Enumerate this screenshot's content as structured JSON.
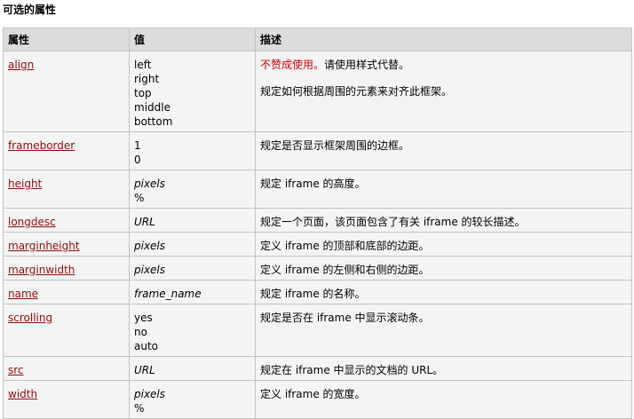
{
  "heading": "可选的属性",
  "columns": [
    "属性",
    "值",
    "描述"
  ],
  "rows": [
    {
      "name": "align",
      "values": [
        "left",
        "right",
        "top",
        "middle",
        "bottom"
      ],
      "italic": false,
      "deprecated": "不赞成使用。",
      "desc_after": "请使用样式代替。",
      "desc2": "规定如何根据周围的元素来对齐此框架。"
    },
    {
      "name": "frameborder",
      "values": [
        "1",
        "0"
      ],
      "italic": false,
      "desc": "规定是否显示框架周围的边框。"
    },
    {
      "name": "height",
      "values": [
        "pixels",
        "%"
      ],
      "italic": true,
      "desc": "规定 iframe 的高度。"
    },
    {
      "name": "longdesc",
      "values": [
        "URL"
      ],
      "italic": true,
      "desc": "规定一个页面，该页面包含了有关 iframe 的较长描述。"
    },
    {
      "name": "marginheight",
      "values": [
        "pixels"
      ],
      "italic": true,
      "desc": "定义 iframe 的顶部和底部的边距。"
    },
    {
      "name": "marginwidth",
      "values": [
        "pixels"
      ],
      "italic": true,
      "desc": "定义 iframe 的左侧和右侧的边距。"
    },
    {
      "name": "name",
      "values": [
        "frame_name"
      ],
      "italic": true,
      "desc": "规定 iframe 的名称。"
    },
    {
      "name": "scrolling",
      "values": [
        "yes",
        "no",
        "auto"
      ],
      "italic": false,
      "desc": "规定是否在 iframe 中显示滚动条。"
    },
    {
      "name": "src",
      "values": [
        "URL"
      ],
      "italic": true,
      "desc": "规定在 iframe 中显示的文档的 URL。"
    },
    {
      "name": "width",
      "values": [
        "pixels",
        "%"
      ],
      "italic": true,
      "desc": "定义 iframe 的宽度。"
    }
  ]
}
